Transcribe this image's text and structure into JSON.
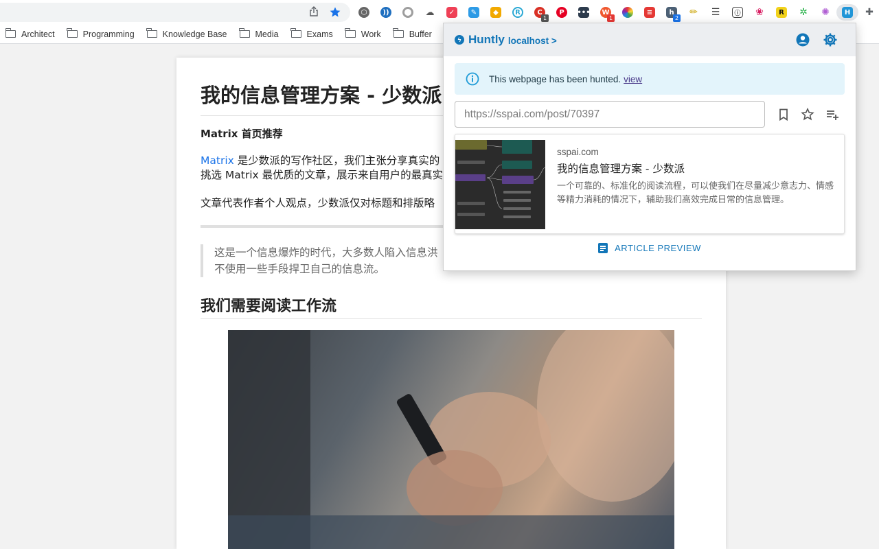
{
  "bookmarks": [
    "Architect",
    "Programming",
    "Knowledge Base",
    "Media",
    "Exams",
    "Work",
    "Buffer"
  ],
  "extensions": {
    "badges": {
      "ext3": "1",
      "ext11": "1",
      "ext14": "2"
    }
  },
  "article": {
    "title": "我的信息管理方案 - 少数派",
    "section_label": "Matrix 首页推荐",
    "para1_link": "Matrix",
    "para1_line1": " 是少数派的写作社区，我们主张分享真实的",
    "para1_line2": "挑选 Matrix 最优质的文章，展示来自用户的最真实",
    "para2": "文章代表作者个人观点，少数派仅对标题和排版略",
    "quote_line1": "这是一个信息爆炸的时代，大多数人陷入信息洪",
    "quote_line2": "不使用一些手段捍卫自己的信息流。",
    "heading2": "我们需要阅读工作流"
  },
  "popup": {
    "brand": "Huntly",
    "host_link": "localhost >",
    "info_text": "This webpage has been hunted.",
    "info_link": "view",
    "url_placeholder": "https://sspai.com/post/70397",
    "card": {
      "site": "sspai.com",
      "title": "我的信息管理方案 - 少数派",
      "description": "一个可靠的、标准化的阅读流程，可以使我们在尽量减少意志力、情感等精力消耗的情况下，辅助我们高效完成日常的信息管理。"
    },
    "preview_label": "ARTICLE PREVIEW"
  },
  "colors": {
    "brand": "#1276b8",
    "info_bg": "#e3f4fb",
    "link": "#1a73e8"
  }
}
